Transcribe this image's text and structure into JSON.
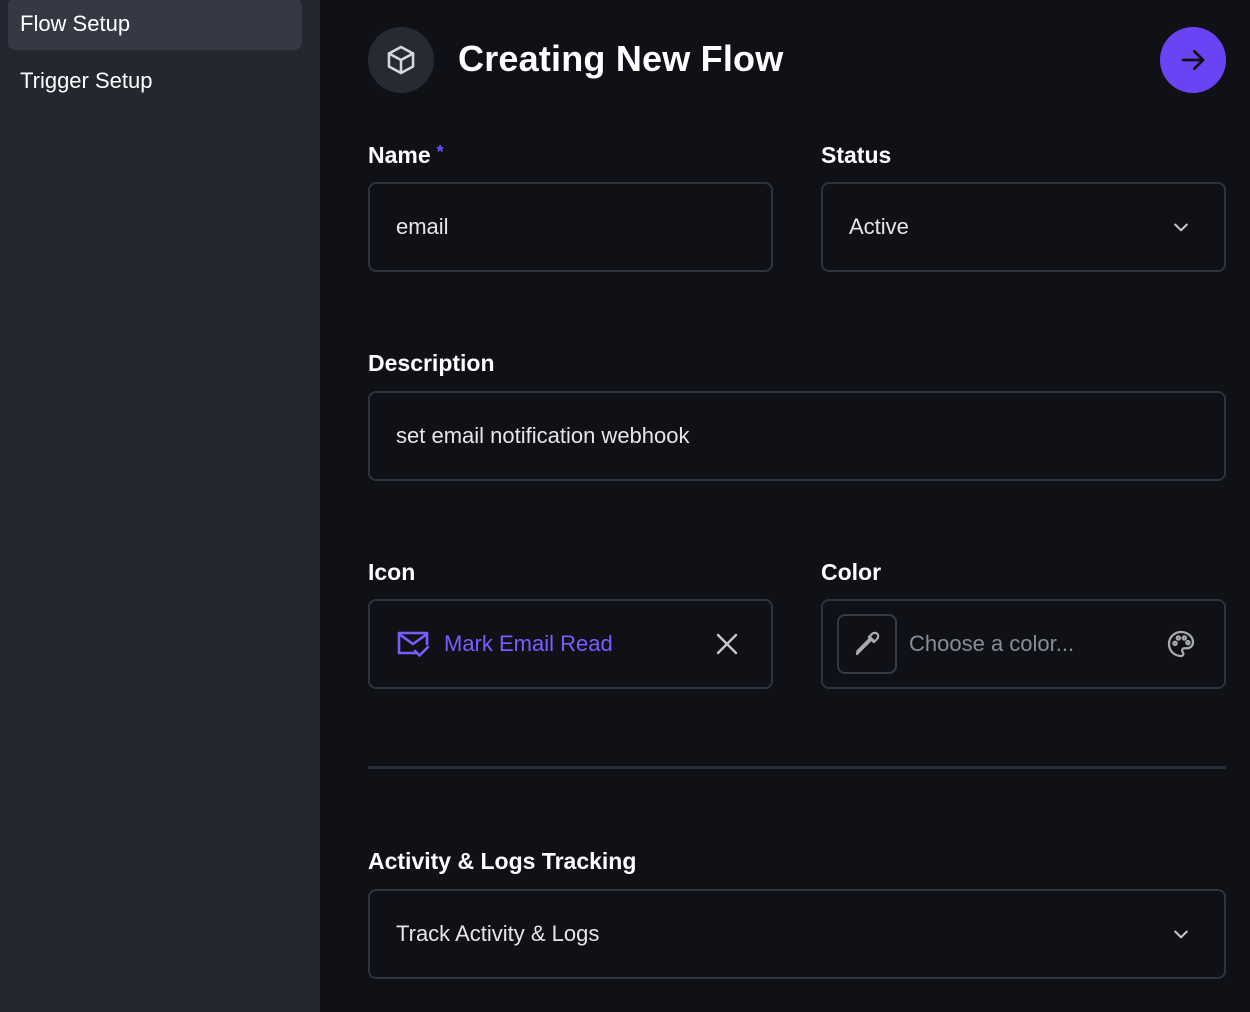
{
  "sidebar": {
    "items": [
      {
        "label": "Flow Setup",
        "active": true
      },
      {
        "label": "Trigger Setup",
        "active": false
      }
    ]
  },
  "header": {
    "title": "Creating New Flow",
    "icon": "cube-icon",
    "next_icon": "arrow-right-icon"
  },
  "form": {
    "name": {
      "label": "Name",
      "required_mark": "*",
      "value": "email"
    },
    "status": {
      "label": "Status",
      "value": "Active"
    },
    "description": {
      "label": "Description",
      "value": "set email notification webhook"
    },
    "icon": {
      "label": "Icon",
      "value": "Mark Email Read",
      "icon": "mark-email-read-icon"
    },
    "color": {
      "label": "Color",
      "placeholder": "Choose a color..."
    },
    "activity": {
      "label": "Activity & Logs Tracking",
      "value": "Track Activity & Logs"
    }
  },
  "colors": {
    "accent": "#6a43f5",
    "icon_text": "#7b5cff",
    "background": "#0f1117",
    "sidebar": "#232730"
  }
}
